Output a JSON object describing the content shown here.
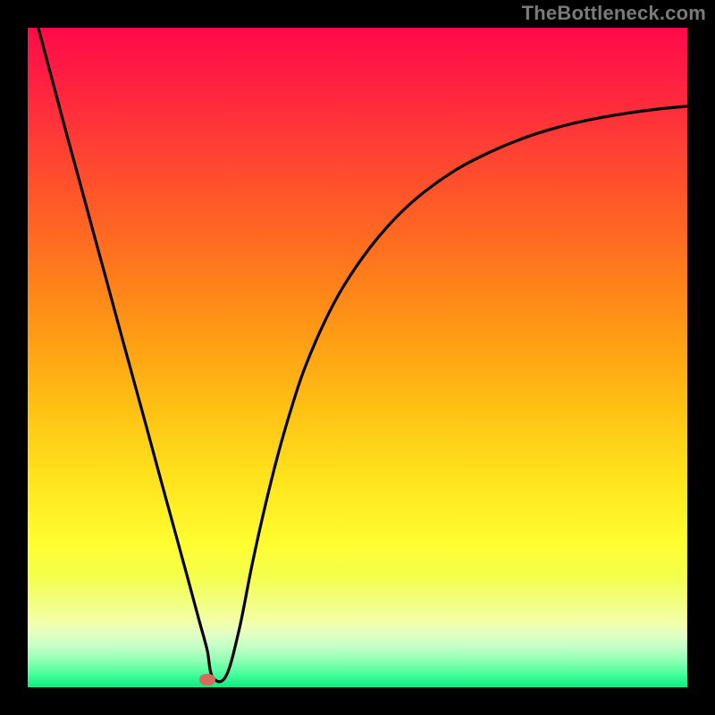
{
  "watermark": "TheBottleneck.com",
  "colors": {
    "frame": "#000000",
    "curve": "#000000",
    "marker": "#d86a5b",
    "gradient_top": "#ff0a49",
    "gradient_bottom": "#05ee82"
  },
  "chart_data": {
    "type": "line",
    "title": "",
    "xlabel": "",
    "ylabel": "",
    "xlim": [
      0,
      100
    ],
    "ylim": [
      0,
      100
    ],
    "grid": false,
    "series": [
      {
        "name": "bottleneck-curve",
        "x": [
          0,
          2,
          4,
          6,
          8,
          10,
          12,
          14,
          16,
          18,
          20,
          22,
          24,
          26,
          27.2,
          28,
          30,
          32,
          34,
          36,
          38,
          40,
          42,
          45,
          48,
          52,
          56,
          60,
          65,
          70,
          75,
          80,
          85,
          90,
          95,
          100
        ],
        "y": [
          106,
          98.5,
          91,
          83.5,
          76.2,
          68.8,
          61.5,
          54.1,
          46.8,
          39.5,
          32.1,
          24.8,
          17.5,
          10.1,
          5.7,
          1.6,
          1.6,
          8.5,
          18.5,
          27.5,
          35.5,
          42.4,
          48.4,
          55.4,
          61.0,
          66.8,
          71.4,
          75.0,
          78.5,
          81.1,
          83.2,
          84.8,
          86.0,
          86.9,
          87.6,
          88.1
        ]
      }
    ],
    "annotations": [
      {
        "name": "bottleneck-marker",
        "x": 27.2,
        "y": 1.2
      }
    ]
  }
}
